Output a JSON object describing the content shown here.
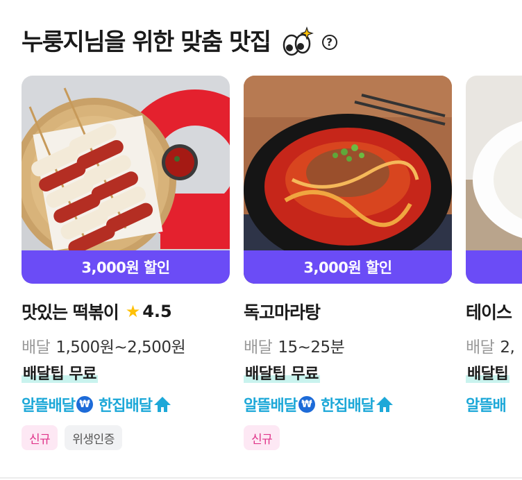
{
  "section": {
    "title": "누룽지님을 위한 맞춤 맛집",
    "eyes_icon": "googly-eyes-sparkle-icon",
    "help_icon_glyph": "?"
  },
  "cards": [
    {
      "image": "tteokbokki-skewer-photo",
      "discount": "3,000원 할인",
      "name": "맛있는 떡볶이",
      "rating": "4.5",
      "delivery_label": "배달",
      "delivery_fee": "1,500원~2,500원",
      "tip": "배달팁 무료",
      "service_1": "알뜰배달",
      "service_1_icon": "₩",
      "service_2": "한집배달",
      "tags": [
        "신규",
        "위생인증"
      ]
    },
    {
      "image": "maratang-bowl-photo",
      "discount": "3,000원 할인",
      "name": "독고마라탕",
      "delivery_label": "배달",
      "delivery_fee": "15~25분",
      "tip": "배달팁 무료",
      "service_1": "알뜰배달",
      "service_1_icon": "₩",
      "service_2": "한집배달",
      "tags": [
        "신규"
      ]
    },
    {
      "image": "plated-dish-photo",
      "name": "테이스",
      "delivery_label": "배달",
      "delivery_fee": "2,",
      "tip": "배달팁",
      "service_1": "알뜰배",
      "tags": []
    }
  ],
  "colors": {
    "discount_banner": "#6b4cf6",
    "service_text": "#1da8d8",
    "tag_new_bg": "#fde8f4",
    "tag_new_text": "#e0348a",
    "tip_highlight": "#c9f3ee",
    "star": "#ffc107"
  }
}
